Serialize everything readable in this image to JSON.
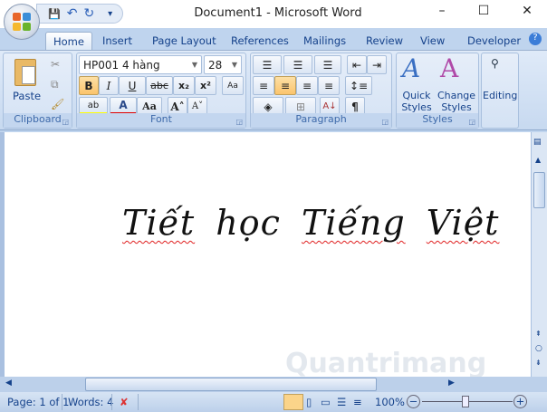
{
  "window": {
    "title": "Document1 - Microsoft Word",
    "controls": {
      "minimize": "–",
      "maximize": "☐",
      "close": "✕"
    }
  },
  "qat": {
    "save": "💾",
    "undo": "↶",
    "redo": "↻",
    "customize": "▾"
  },
  "tabs": [
    "Home",
    "Insert",
    "Page Layout",
    "References",
    "Mailings",
    "Review",
    "View",
    "Developer"
  ],
  "help": "?",
  "clipboard": {
    "paste": "Paste",
    "label": "Clipboard"
  },
  "font": {
    "name": "HP001 4 hàng",
    "size": "28",
    "bold": "B",
    "italic": "I",
    "underline": "U",
    "strike": "abc",
    "sub": "x₂",
    "sup": "x²",
    "grow": "A˄",
    "shrink": "A˅",
    "case": "Aa",
    "color": "A",
    "highlight": "ab",
    "label": "Font",
    "colors": {
      "highlight": "#ffff00",
      "font": "#e00000"
    }
  },
  "paragraph": {
    "label": "Paragraph",
    "pilcrow": "¶",
    "sort": "A↓"
  },
  "styles": {
    "quick": "Quick Styles",
    "change": "Change Styles",
    "label": "Styles"
  },
  "editing": {
    "label": "Editing"
  },
  "document": {
    "words": [
      "Tiết",
      "học",
      "Tiếng",
      "Việt"
    ]
  },
  "status": {
    "page": "Page: 1 of 1",
    "words": "Words: 4",
    "zoom": "100%",
    "zoom_level": 100
  },
  "watermark": "Quantrimang"
}
